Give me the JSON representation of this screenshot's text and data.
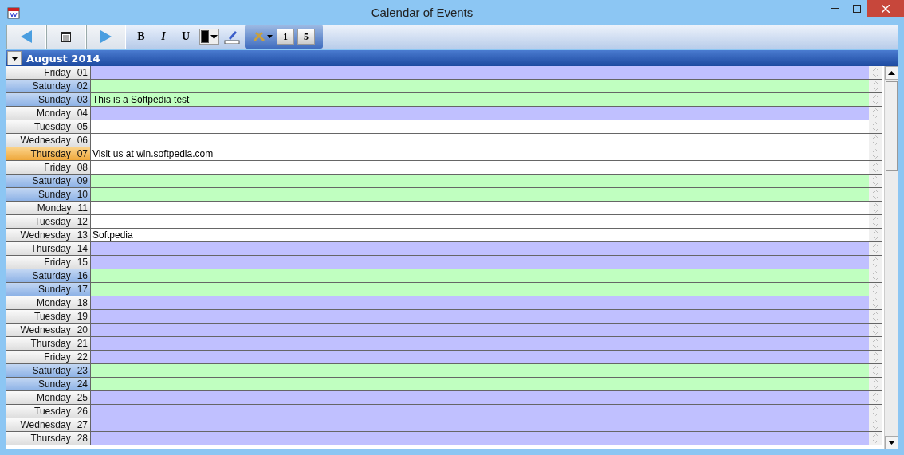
{
  "window": {
    "title": "Calendar of Events"
  },
  "toolbar": {
    "format_buttons": [
      {
        "label": "B",
        "kind": "bold"
      },
      {
        "label": "I",
        "kind": "italic"
      },
      {
        "label": "U",
        "kind": "underline"
      }
    ],
    "view_buttons": [
      "1",
      "5"
    ]
  },
  "month": {
    "title": "August 2014"
  },
  "days": [
    {
      "day": "Friday",
      "date": "01",
      "kind": "weekday",
      "color": "#c0c0ff"
    },
    {
      "day": "Saturday",
      "date": "02",
      "kind": "weekend",
      "color": "#c0ffc0"
    },
    {
      "day": "Sunday",
      "date": "03",
      "kind": "weekend",
      "color": "#c0ffc0",
      "event": "This is a Softpedia test"
    },
    {
      "day": "Monday",
      "date": "04",
      "kind": "weekday",
      "color": "#c0c0ff"
    },
    {
      "day": "Tuesday",
      "date": "05",
      "kind": "weekday",
      "color": "#ffffff"
    },
    {
      "day": "Wednesday",
      "date": "06",
      "kind": "weekday",
      "color": "#ffffff"
    },
    {
      "day": "Thursday",
      "date": "07",
      "kind": "today",
      "color": "#ffffff",
      "event": "Visit us at win.softpedia.com"
    },
    {
      "day": "Friday",
      "date": "08",
      "kind": "weekday",
      "color": "#ffffff"
    },
    {
      "day": "Saturday",
      "date": "09",
      "kind": "weekend",
      "color": "#c0ffc0"
    },
    {
      "day": "Sunday",
      "date": "10",
      "kind": "weekend",
      "color": "#c0ffc0"
    },
    {
      "day": "Monday",
      "date": "11",
      "kind": "weekday",
      "color": "#ffffff"
    },
    {
      "day": "Tuesday",
      "date": "12",
      "kind": "weekday",
      "color": "#ffffff"
    },
    {
      "day": "Wednesday",
      "date": "13",
      "kind": "weekday",
      "color": "#ffffff",
      "event": "Softpedia"
    },
    {
      "day": "Thursday",
      "date": "14",
      "kind": "weekday",
      "color": "#c0c0ff"
    },
    {
      "day": "Friday",
      "date": "15",
      "kind": "weekday",
      "color": "#c0c0ff"
    },
    {
      "day": "Saturday",
      "date": "16",
      "kind": "weekend",
      "color": "#c0ffc0"
    },
    {
      "day": "Sunday",
      "date": "17",
      "kind": "weekend",
      "color": "#c0ffc0"
    },
    {
      "day": "Monday",
      "date": "18",
      "kind": "weekday",
      "color": "#c0c0ff"
    },
    {
      "day": "Tuesday",
      "date": "19",
      "kind": "weekday",
      "color": "#c0c0ff"
    },
    {
      "day": "Wednesday",
      "date": "20",
      "kind": "weekday",
      "color": "#c0c0ff"
    },
    {
      "day": "Thursday",
      "date": "21",
      "kind": "weekday",
      "color": "#c0c0ff"
    },
    {
      "day": "Friday",
      "date": "22",
      "kind": "weekday",
      "color": "#c0c0ff"
    },
    {
      "day": "Saturday",
      "date": "23",
      "kind": "weekend",
      "color": "#c0ffc0"
    },
    {
      "day": "Sunday",
      "date": "24",
      "kind": "weekend",
      "color": "#c0ffc0"
    },
    {
      "day": "Monday",
      "date": "25",
      "kind": "weekday",
      "color": "#c0c0ff"
    },
    {
      "day": "Tuesday",
      "date": "26",
      "kind": "weekday",
      "color": "#c0c0ff"
    },
    {
      "day": "Wednesday",
      "date": "27",
      "kind": "weekday",
      "color": "#c0c0ff"
    },
    {
      "day": "Thursday",
      "date": "28",
      "kind": "weekday",
      "color": "#c0c0ff"
    }
  ]
}
